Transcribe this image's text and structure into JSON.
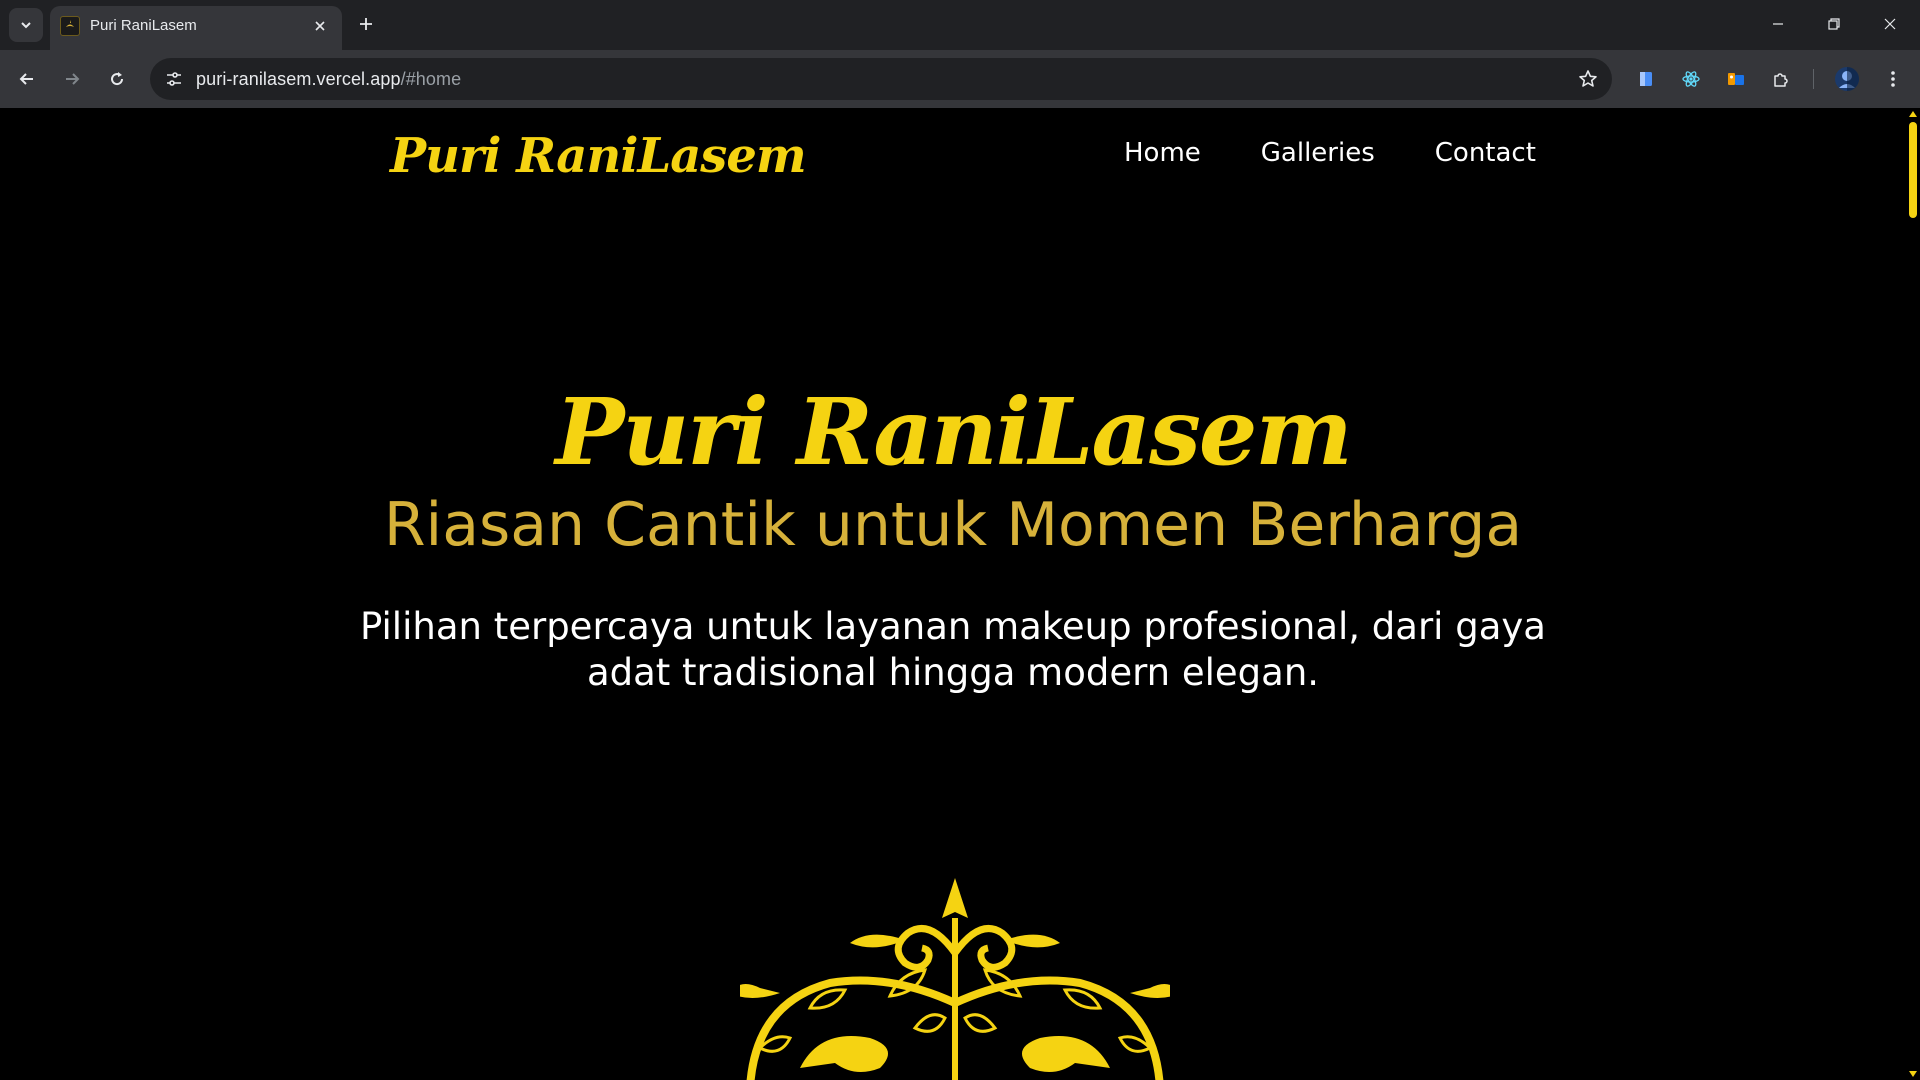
{
  "browser": {
    "tab": {
      "title": "Puri RaniLasem"
    },
    "address": {
      "host": "puri-ranilasem.vercel.app",
      "path": "/#home"
    }
  },
  "site": {
    "logo": "Puri RaniLasem",
    "nav": [
      {
        "label": "Home"
      },
      {
        "label": "Galleries"
      },
      {
        "label": "Contact"
      }
    ],
    "hero": {
      "title": "Puri RaniLasem",
      "subtitle": "Riasan Cantik untuk Momen Berharga",
      "description": "Pilihan terpercaya untuk layanan makeup profesional, dari gaya adat tradisional hingga modern elegan."
    },
    "colors": {
      "accent": "#f5d312",
      "subtitle": "#d6b13a",
      "background": "#000000"
    }
  }
}
